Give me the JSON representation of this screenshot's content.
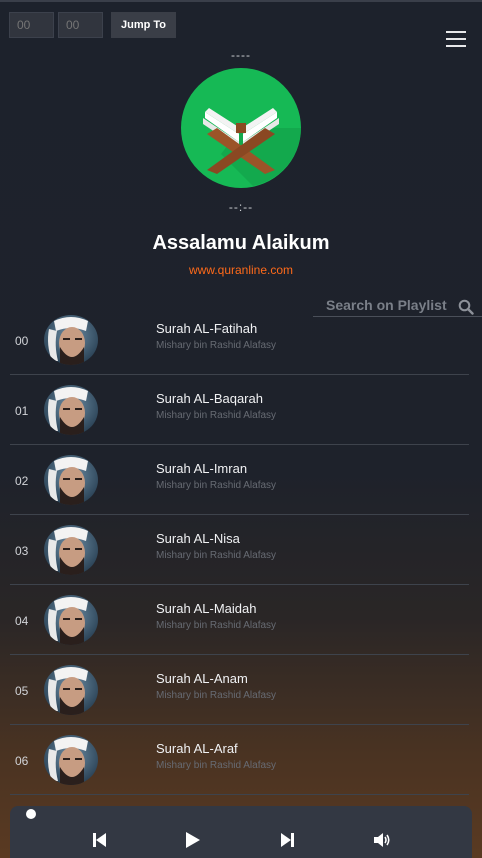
{
  "jump": {
    "minutes_placeholder": "00",
    "seconds_placeholder": "00",
    "button_label": "Jump To"
  },
  "now_playing": {
    "elapsed": "----",
    "duration": "--:--",
    "greeting": "Assalamu Alaikum",
    "site": "www.quranline.com"
  },
  "search": {
    "placeholder": "Search on Playlist"
  },
  "playlist": [
    {
      "num": "00",
      "title": "Surah AL-Fatihah",
      "artist": "Mishary bin Rashid Alafasy"
    },
    {
      "num": "01",
      "title": "Surah AL-Baqarah",
      "artist": "Mishary bin Rashid Alafasy"
    },
    {
      "num": "02",
      "title": "Surah AL-Imran",
      "artist": "Mishary bin Rashid Alafasy"
    },
    {
      "num": "03",
      "title": "Surah AL-Nisa",
      "artist": "Mishary bin Rashid Alafasy"
    },
    {
      "num": "04",
      "title": "Surah AL-Maidah",
      "artist": "Mishary bin Rashid Alafasy"
    },
    {
      "num": "05",
      "title": "Surah AL-Anam",
      "artist": "Mishary bin Rashid Alafasy"
    },
    {
      "num": "06",
      "title": "Surah AL-Araf",
      "artist": "Mishary bin Rashid Alafasy"
    }
  ],
  "player": {
    "progress": 0,
    "icons": [
      "previous-icon",
      "play-icon",
      "next-icon",
      "volume-icon"
    ]
  },
  "colors": {
    "accent": "#ff6a1a",
    "logo_green": "#1db954"
  }
}
